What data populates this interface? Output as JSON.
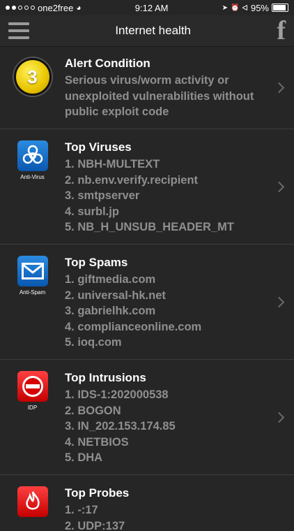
{
  "status": {
    "carrier": "one2free",
    "time": "9:12 AM",
    "battery": "95%"
  },
  "header": {
    "title": "Internet health"
  },
  "alert": {
    "level": "3",
    "title": "Alert Condition",
    "lines": [
      "Serious virus/worm activity or",
      "unexploited vulnerabilities without",
      "public exploit code"
    ]
  },
  "viruses": {
    "icon_label": "Anti-Virus",
    "title": "Top Viruses",
    "items": [
      "1. NBH-MULTEXT",
      "2. nb.env.verify.recipient",
      "3. smtpserver",
      "4. surbl.jp",
      "5. NB_H_UNSUB_HEADER_MT"
    ]
  },
  "spams": {
    "icon_label": "Anti-Spam",
    "title": "Top Spams",
    "items": [
      "1. giftmedia.com",
      "2. universal-hk.net",
      "3. gabrielhk.com",
      "4. complianceonline.com",
      "5. ioq.com"
    ]
  },
  "intrusions": {
    "icon_label": "IDP",
    "title": "Top Intrusions",
    "items": [
      "1. IDS-1:202000538",
      "2. BOGON",
      "3. IN_202.153.174.85",
      "4. NETBIOS",
      "5. DHA"
    ]
  },
  "probes": {
    "title": "Top Probes",
    "items": [
      "1. -:17",
      "2. UDP:137"
    ]
  }
}
